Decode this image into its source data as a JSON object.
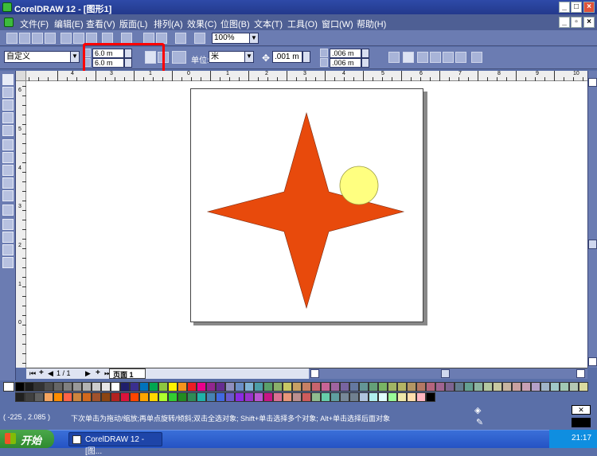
{
  "window": {
    "title": "CorelDRAW 12 - [图形1]"
  },
  "menu": [
    "文件(F)",
    "编辑(E)",
    "查看(V)",
    "版面(L)",
    "排列(A)",
    "效果(C)",
    "位图(B)",
    "文本(T)",
    "工具(O)",
    "窗口(W)",
    "帮助(H)"
  ],
  "toolbar": {
    "zoom": "100%"
  },
  "propbar": {
    "paper_preset": "自定义",
    "width": "6.0 m",
    "height": "6.0 m",
    "units_label": "单位:",
    "units_value": "米",
    "nudge": ".001 m",
    "dup_x": ".006 m",
    "dup_y": ".006 m"
  },
  "ruler": {
    "h_numbers": [
      "4",
      "3",
      "2",
      "1",
      "0",
      "1",
      "2",
      "3",
      "4",
      "5",
      "6",
      "7",
      "8",
      "9",
      "10"
    ],
    "v_numbers": [
      "6",
      "5",
      "4",
      "3",
      "2",
      "1",
      "0"
    ]
  },
  "page_tabs": {
    "page_count": "1 / 1",
    "page_name": "页面 1"
  },
  "palette": {
    "row1": [
      "#000000",
      "#1a1a1a",
      "#333333",
      "#4d4d4d",
      "#666666",
      "#808080",
      "#999999",
      "#b3b3b3",
      "#cccccc",
      "#e6e6e6",
      "#ffffff",
      "#1f1f6b",
      "#3a2f8f",
      "#0072bc",
      "#00a651",
      "#8dc63f",
      "#fff200",
      "#f7941d",
      "#ed1c24",
      "#ec008c",
      "#92278f",
      "#662d91",
      "#8f8fbf",
      "#6b8fc7",
      "#7fb3d5",
      "#4c9ea8",
      "#5aa06a",
      "#8ab06a",
      "#c8c864",
      "#c8a064",
      "#c88064",
      "#c8646e",
      "#c86496",
      "#a064a0",
      "#7864a0",
      "#6478a0",
      "#649696",
      "#64a078",
      "#78b464",
      "#a0b464",
      "#b4b464",
      "#b49664",
      "#b47864",
      "#b4647d",
      "#a06491",
      "#7d6491",
      "#647d91",
      "#64a091",
      "#8cb4a0",
      "#b4c8a0",
      "#c8c8a0",
      "#c8b4a0",
      "#c8a0a0",
      "#c8a0b4",
      "#b4a0c8",
      "#a0b4c8",
      "#a0c8c8",
      "#a0c8b4",
      "#b4c8b4",
      "#dcdca0",
      "#f0e68c",
      "#f5deb3"
    ],
    "row2": [
      "#202020",
      "#404040",
      "#606060",
      "#f4a460",
      "#ff8c00",
      "#ff6347",
      "#cd853f",
      "#d2691e",
      "#a0522d",
      "#8b4513",
      "#b22222",
      "#dc143c",
      "#ff4500",
      "#ffa500",
      "#ffd700",
      "#adff2f",
      "#32cd32",
      "#228b22",
      "#2e8b57",
      "#20b2aa",
      "#4682b4",
      "#4169e1",
      "#6a5acd",
      "#8a2be2",
      "#9932cc",
      "#ba55d3",
      "#c71585",
      "#db7093",
      "#e9967a",
      "#bc8f8f",
      "#cd5c5c",
      "#8fbc8f",
      "#66cdaa",
      "#5f9ea0",
      "#778899",
      "#708090",
      "#b0c4de",
      "#afeeee",
      "#e0ffff",
      "#98fb98",
      "#eee8aa",
      "#ffdead",
      "#ffb6c1",
      "#000000"
    ]
  },
  "status": {
    "coords": "( -225 , 2.085 )",
    "hint": "下次单击为拖动/缩放;再单点旋转/倾斜;双击全选对象; Shift+单击选择多个对象; Alt+单击选择后面对象"
  },
  "taskbar": {
    "start": "开始",
    "task": "CorelDRAW 12 - [图...",
    "clock": "21:17"
  },
  "colors": {
    "star": "#e84a0c",
    "circle": "#ffff80",
    "highlight": "#ff0000"
  }
}
